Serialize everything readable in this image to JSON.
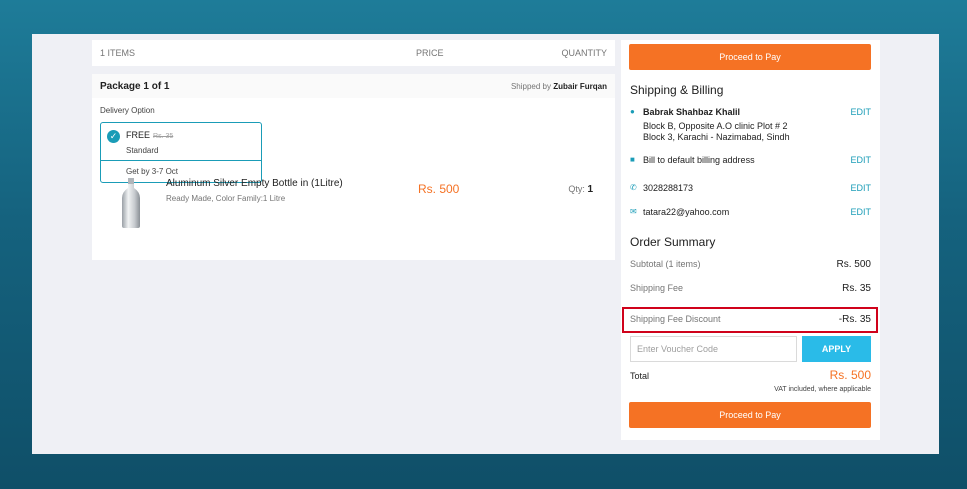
{
  "cart": {
    "header": {
      "items": "1 ITEMS",
      "price": "PRICE",
      "quantity": "QUANTITY"
    },
    "package": {
      "title": "Package 1 of 1",
      "shipped_by_label": "Shipped by",
      "shipped_by_name": "Zubair Furqan",
      "delivery_option_label": "Delivery Option",
      "option": {
        "free_label": "FREE",
        "old_price": "Rs. 35",
        "type": "Standard",
        "get_by": "Get by 3-7 Oct"
      },
      "product": {
        "name": "Aluminum Silver Empty Bottle in (1Litre)",
        "attributes": "Ready Made, Color Family:1 Litre",
        "price": "Rs. 500",
        "qty_label": "Qty:",
        "qty_value": "1"
      }
    }
  },
  "side": {
    "proceed_label": "Proceed to Pay",
    "shipping_title": "Shipping & Billing",
    "address": {
      "name": "Babrak Shahbaz Khalil",
      "line1": "Block B, Opposite A.O clinic Plot # 2",
      "line2": "Block 3, Karachi - Nazimabad, Sindh",
      "edit": "EDIT"
    },
    "billing": {
      "text": "Bill to default billing address",
      "edit": "EDIT"
    },
    "phone": {
      "text": "3028288173",
      "edit": "EDIT"
    },
    "email": {
      "text": "tatara22@yahoo.com",
      "edit": "EDIT"
    },
    "summary_title": "Order Summary",
    "subtotal": {
      "label": "Subtotal (1 items)",
      "value": "Rs. 500"
    },
    "shipping_fee": {
      "label": "Shipping Fee",
      "value": "Rs. 35"
    },
    "shipping_discount": {
      "label": "Shipping Fee Discount",
      "value": "-Rs. 35"
    },
    "voucher_placeholder": "Enter Voucher Code",
    "apply_label": "APPLY",
    "total": {
      "label": "Total",
      "value": "Rs. 500",
      "vat_note": "VAT included, where applicable"
    }
  },
  "colors": {
    "accent": "#f57224",
    "link": "#1a9cb7",
    "apply": "#2abbe8",
    "highlight": "#d0021b"
  }
}
